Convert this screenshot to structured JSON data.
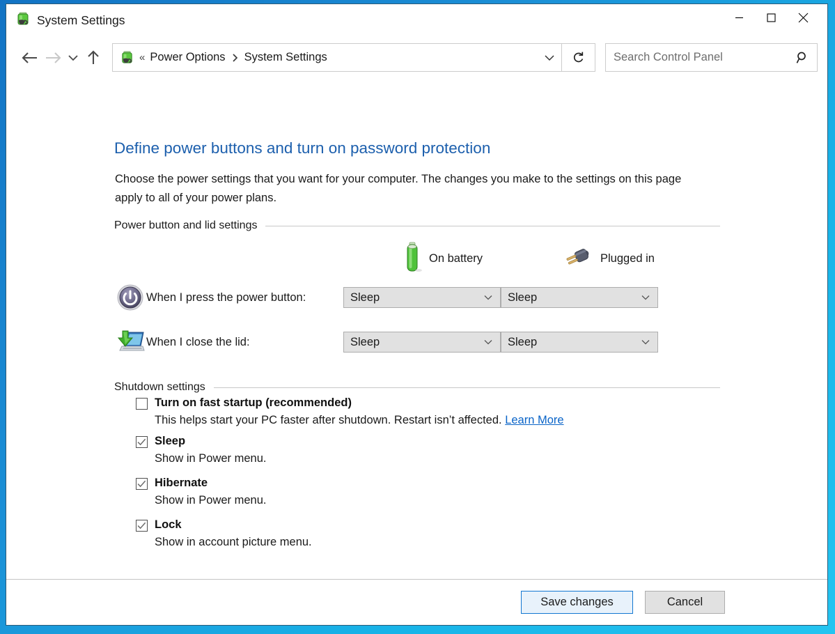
{
  "window": {
    "title": "System Settings",
    "title_icon": "power-battery-icon",
    "controls": {
      "minimize": "minimize-icon",
      "maximize": "maximize-icon",
      "close": "close-icon"
    }
  },
  "addressbar": {
    "back": "back-arrow-icon",
    "forward": "forward-arrow-icon",
    "recent": "recent-pages-chevron-icon",
    "up": "up-arrow-icon",
    "breadcrumb_icon": "power-battery-icon",
    "breadcrumb_prefix": "«",
    "crumbs": [
      "Power Options",
      "System Settings"
    ],
    "crumb_separator": "›",
    "dropdown": "chevron-down-icon",
    "refresh": "refresh-icon",
    "search": {
      "placeholder": "Search Control Panel",
      "value": "",
      "icon": "search-icon"
    }
  },
  "page": {
    "heading": "Define power buttons and turn on password protection",
    "description": "Choose the power settings that you want for your computer. The changes you make to the settings on this page apply to all of your power plans."
  },
  "power_group": {
    "title": "Power button and lid settings",
    "columns": [
      {
        "label": "On battery",
        "icon": "battery-icon"
      },
      {
        "label": "Plugged in",
        "icon": "power-plug-icon"
      }
    ],
    "rows": [
      {
        "icon": "power-button-icon",
        "label": "When I press the power button:",
        "on_battery": "Sleep",
        "plugged_in": "Sleep"
      },
      {
        "icon": "laptop-close-lid-icon",
        "label": "When I close the lid:",
        "on_battery": "Sleep",
        "plugged_in": "Sleep"
      }
    ]
  },
  "shutdown_group": {
    "title": "Shutdown settings",
    "items": [
      {
        "label": "Turn on fast startup (recommended)",
        "checked": false,
        "description": "This helps start your PC faster after shutdown. Restart isn’t affected.",
        "link": "Learn More"
      },
      {
        "label": "Sleep",
        "checked": true,
        "description": "Show in Power menu.",
        "link": ""
      },
      {
        "label": "Hibernate",
        "checked": true,
        "description": "Show in Power menu.",
        "link": ""
      },
      {
        "label": "Lock",
        "checked": true,
        "description": "Show in account picture menu.",
        "link": ""
      }
    ]
  },
  "footer": {
    "save_label": "Save changes",
    "cancel_label": "Cancel"
  },
  "colors": {
    "heading_blue": "#1c5fad",
    "link_blue": "#0a64c8",
    "accent_border": "#1177d1",
    "control_gray": "#e1e1e1",
    "battery_green": "#4fc23a"
  }
}
